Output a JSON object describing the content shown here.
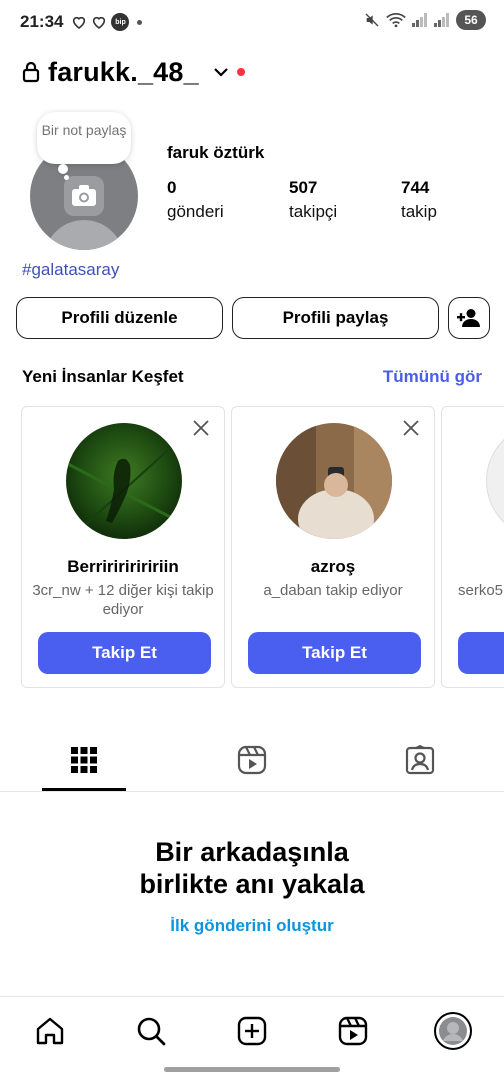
{
  "status_bar": {
    "time": "21:34",
    "bip_label": "bip",
    "battery": "56",
    "icons": [
      "heart-outline-icon",
      "heart-outline-icon",
      "bip-app-icon",
      "mute-icon",
      "wifi-icon",
      "signal-icon",
      "signal-icon"
    ]
  },
  "header": {
    "username": "farukk._48_",
    "has_notification_dot": true
  },
  "profile": {
    "note_text": "Bir not paylaş",
    "full_name": "faruk öztürk",
    "stats": [
      {
        "value": "0",
        "label": "gönderi"
      },
      {
        "value": "507",
        "label": "takipçi"
      },
      {
        "value": "744",
        "label": "takip"
      }
    ],
    "bio_hashtag": "#galatasaray"
  },
  "actions": {
    "edit_label": "Profili düzenle",
    "share_label": "Profili paylaş"
  },
  "discover": {
    "title": "Yeni İnsanlar Keşfet",
    "see_all": "Tümünü gör",
    "cards": [
      {
        "name": "Berririririririin",
        "subtitle": "3cr_nw + 12 diğer kişi takip ediyor",
        "button": "Takip Et"
      },
      {
        "name": "azroş",
        "subtitle": "a_daban takip ediyor",
        "button": "Takip Et"
      },
      {
        "name": "",
        "subtitle": "serko5",
        "button": ""
      }
    ]
  },
  "tabs": [
    "grid-icon",
    "reels-icon",
    "tagged-icon"
  ],
  "empty_state": {
    "title_line1": "Bir arkadaşınla",
    "title_line2": "birlikte anı yakala",
    "link": "İlk gönderini oluştur"
  },
  "bottom_nav": [
    "home-icon",
    "search-icon",
    "create-icon",
    "reels-icon",
    "profile-avatar"
  ],
  "colors": {
    "accent_blue": "#4a5ef0",
    "link_blue": "#0a95e0",
    "hashtag": "#3f51b5",
    "notification_red": "#ff3040"
  }
}
